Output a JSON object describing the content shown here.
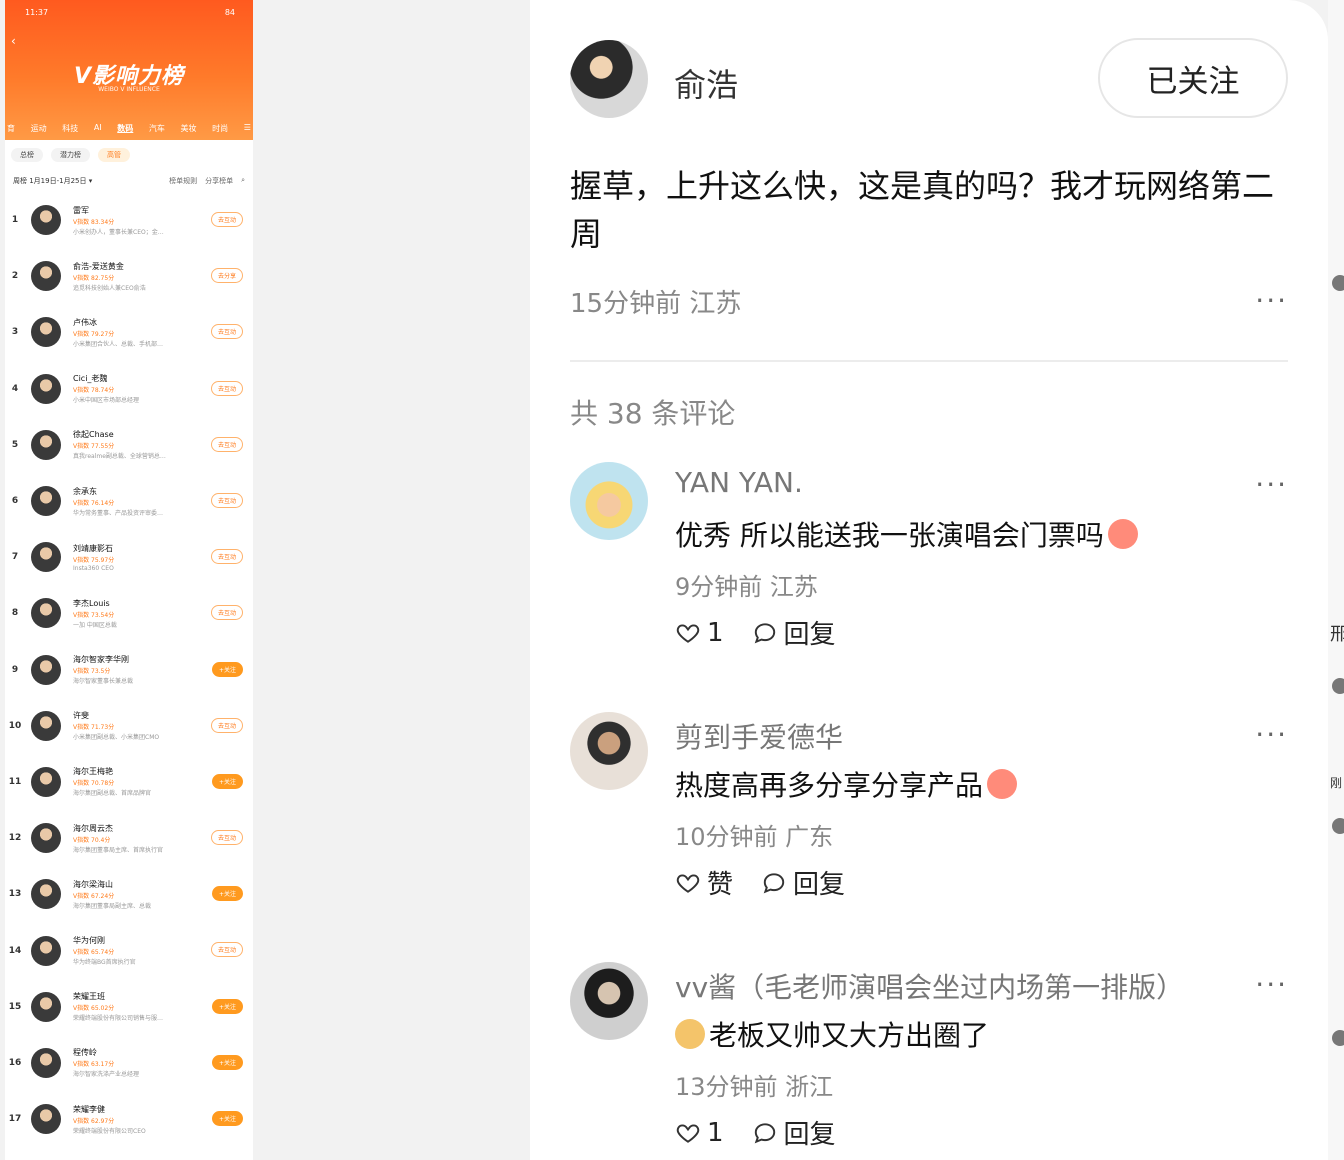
{
  "left_screenshot": {
    "status_time": "11:37",
    "status_battery": "84",
    "title": "V影响力榜",
    "subtitle": "WEIBO V INFLUENCE",
    "categories": [
      "育",
      "运动",
      "科技",
      "AI",
      "数码",
      "汽车",
      "美妆",
      "时尚",
      "☰"
    ],
    "active_category": "数码",
    "subtabs": [
      "总榜",
      "潜力榜",
      "高管"
    ],
    "active_subtab": "高管",
    "filter_label": "周榜 1月19日-1月25日 ▾",
    "filter_actions": [
      "榜单规则",
      "分享榜单"
    ],
    "items": [
      {
        "rank": "1",
        "name": "雷军",
        "score": "V指数 83.34分",
        "desc": "小米创办人，董事长兼CEO；金…",
        "btn": "去互动",
        "solid": false
      },
      {
        "rank": "2",
        "name": "俞浩-爱送黄金",
        "score": "V指数 82.75分",
        "desc": "追觅科技创始人兼CEO俞浩",
        "btn": "去分享",
        "solid": false
      },
      {
        "rank": "3",
        "name": "卢伟冰",
        "score": "V指数 79.27分",
        "desc": "小米集团合伙人、总裁、手机部…",
        "btn": "去互动",
        "solid": false
      },
      {
        "rank": "4",
        "name": "Cici_老魏",
        "score": "V指数 78.74分",
        "desc": "小米中国区市场部总经理",
        "btn": "去互动",
        "solid": false
      },
      {
        "rank": "5",
        "name": "徐起Chase",
        "score": "V指数 77.55分",
        "desc": "真我realme副总裁、全球营销总…",
        "btn": "去互动",
        "solid": false
      },
      {
        "rank": "6",
        "name": "余承东",
        "score": "V指数 76.14分",
        "desc": "华为常务董事、产品投资评审委…",
        "btn": "去互动",
        "solid": false
      },
      {
        "rank": "7",
        "name": "刘靖康影石",
        "score": "V指数 75.97分",
        "desc": "Insta360 CEO",
        "btn": "去互动",
        "solid": false
      },
      {
        "rank": "8",
        "name": "李杰Louis",
        "score": "V指数 73.54分",
        "desc": "一加 中国区总裁",
        "btn": "去互动",
        "solid": false
      },
      {
        "rank": "9",
        "name": "海尔智家李华刚",
        "score": "V指数 73.5分",
        "desc": "海尔智家董事长兼总裁",
        "btn": "+关注",
        "solid": true
      },
      {
        "rank": "10",
        "name": "许斐",
        "score": "V指数 71.73分",
        "desc": "小米集团副总裁、小米集团CMO",
        "btn": "去互动",
        "solid": false
      },
      {
        "rank": "11",
        "name": "海尔王梅艳",
        "score": "V指数 70.78分",
        "desc": "海尔集团副总裁、首席品牌官",
        "btn": "+关注",
        "solid": true
      },
      {
        "rank": "12",
        "name": "海尔周云杰",
        "score": "V指数 70.4分",
        "desc": "海尔集团董事局主席、首席执行官",
        "btn": "去互动",
        "solid": false
      },
      {
        "rank": "13",
        "name": "海尔梁海山",
        "score": "V指数 67.24分",
        "desc": "海尔集团董事局副主席、总裁",
        "btn": "+关注",
        "solid": true
      },
      {
        "rank": "14",
        "name": "华为何刚",
        "score": "V指数 65.74分",
        "desc": "华为终端BG首席执行官",
        "btn": "去互动",
        "solid": false
      },
      {
        "rank": "15",
        "name": "荣耀王班",
        "score": "V指数 65.02分",
        "desc": "荣耀终端股份有限公司销售与服…",
        "btn": "+关注",
        "solid": true
      },
      {
        "rank": "16",
        "name": "程传岭",
        "score": "V指数 63.17分",
        "desc": "海尔智家洗涤产业总经理",
        "btn": "+关注",
        "solid": true
      },
      {
        "rank": "17",
        "name": "荣耀李健",
        "score": "V指数 62.97分",
        "desc": "荣耀终端股份有限公司CEO",
        "btn": "+关注",
        "solid": true
      }
    ]
  },
  "post": {
    "author": "俞浩",
    "follow_label": "已关注",
    "text": "握草，上升这么快，这是真的吗？我才玩网络第二周",
    "meta": "15分钟前 江苏",
    "more_label": "···"
  },
  "comments_count": "共 38 条评论",
  "comments": [
    {
      "user": "YAN YAN.",
      "text": "优秀 所以能送我一张演唱会门票吗",
      "meta": "9分钟前 江苏",
      "like": "1",
      "reply": "回复",
      "emoji_pos": "end"
    },
    {
      "user": "剪到手爱德华",
      "text": "热度高再多分享分享产品",
      "meta": "10分钟前 广东",
      "like": "赞",
      "reply": "回复",
      "emoji_pos": "end"
    },
    {
      "user": "vv酱（毛老师演唱会坐过内场第一排版）",
      "text": "老板又帅又大方出圈了",
      "meta": "13分钟前 浙江",
      "like": "1",
      "reply": "回复",
      "emoji_pos": "start"
    }
  ],
  "edge_text": [
    "邢",
    "刚"
  ]
}
